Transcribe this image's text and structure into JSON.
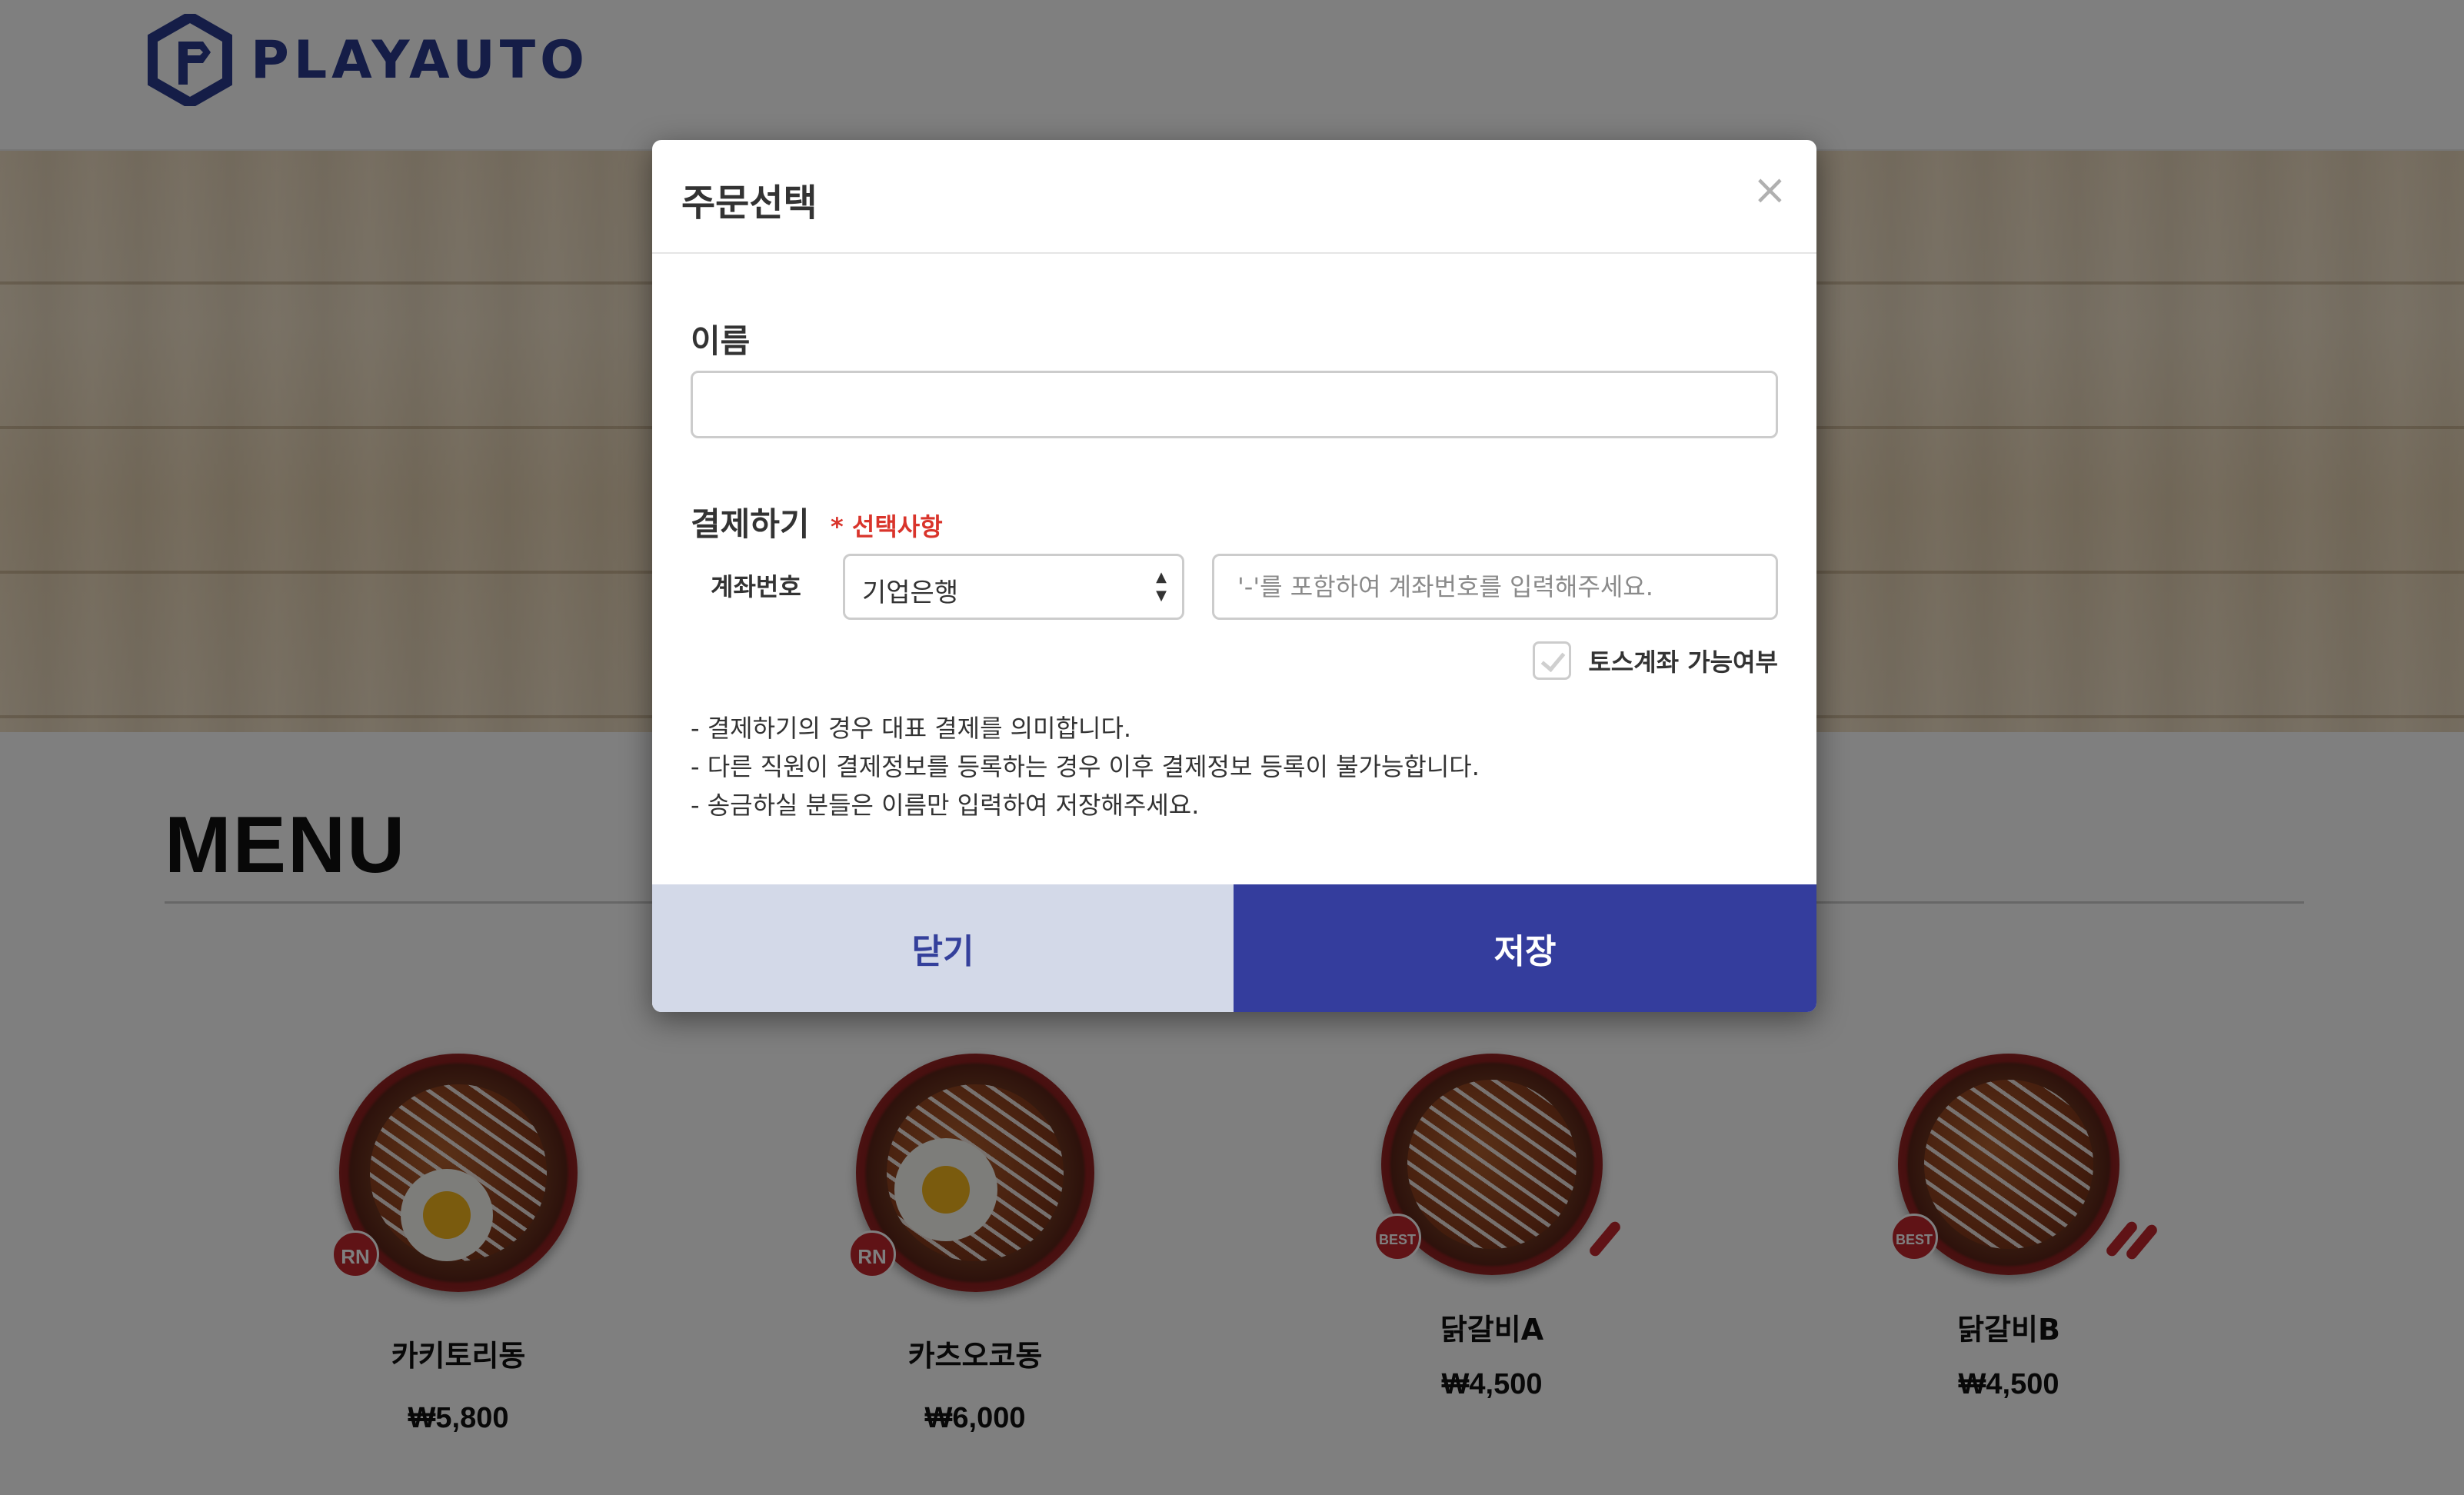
{
  "header": {
    "logo_text": "PLAYAUTO",
    "logo_color": "#2a3b8f"
  },
  "menu": {
    "title": "MENU",
    "items": [
      {
        "name": "카키토리동",
        "price": "₩5,800",
        "badge": "RN"
      },
      {
        "name": "카츠오코동",
        "price": "₩6,000",
        "badge": "RN"
      },
      {
        "name": "닭갈비A",
        "price": "₩4,500",
        "badge": "BEST"
      },
      {
        "name": "닭갈비B",
        "price": "₩4,500",
        "badge": "BEST"
      }
    ]
  },
  "modal": {
    "title": "주문선택",
    "close_icon": "×",
    "name_label": "이름",
    "name_value": "",
    "pay_label": "결제하기",
    "optional_label": "* 선택사항",
    "account_label": "계좌번호",
    "bank_selected": "기업은행",
    "account_placeholder": "'-'를 포함하여 계좌번호를 입력해주세요.",
    "toss_label": "토스계좌 가능여부",
    "notes": [
      "- 결제하기의 경우 대표 결제를 의미합니다.",
      "- 다른 직원이 결제정보를 등록하는 경우 이후 결제정보 등록이 불가능합니다.",
      "- 송금하실 분들은 이름만 입력하여 저장해주세요."
    ],
    "close_button": "닫기",
    "save_button": "저장"
  },
  "colors": {
    "primary": "#343d9d",
    "secondary_button_bg": "#d3d9e8",
    "optional_red": "#d9342b",
    "badge_red": "#c0272d"
  }
}
